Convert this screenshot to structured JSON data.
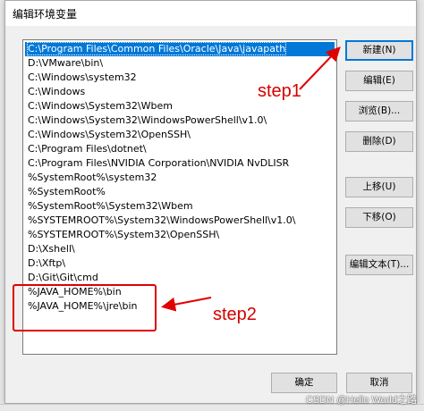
{
  "dialog": {
    "title": "编辑环境变量"
  },
  "paths": [
    "C:\\Program Files\\Common Files\\Oracle\\Java\\javapath",
    "D:\\VMware\\bin\\",
    "C:\\Windows\\system32",
    "C:\\Windows",
    "C:\\Windows\\System32\\Wbem",
    "C:\\Windows\\System32\\WindowsPowerShell\\v1.0\\",
    "C:\\Windows\\System32\\OpenSSH\\",
    "C:\\Program Files\\dotnet\\",
    "C:\\Program Files\\NVIDIA Corporation\\NVIDIA NvDLISR",
    "%SystemRoot%\\system32",
    "%SystemRoot%",
    "%SystemRoot%\\System32\\Wbem",
    "%SYSTEMROOT%\\System32\\WindowsPowerShell\\v1.0\\",
    "%SYSTEMROOT%\\System32\\OpenSSH\\",
    "D:\\Xshell\\",
    "D:\\Xftp\\",
    "D:\\Git\\Git\\cmd",
    "%JAVA_HOME%\\bin",
    "%JAVA_HOME%\\jre\\bin"
  ],
  "buttons": {
    "new": "新建(N)",
    "edit": "编辑(E)",
    "browse": "浏览(B)...",
    "delete": "删除(D)",
    "move_up": "上移(U)",
    "move_down": "下移(O)",
    "edit_text": "编辑文本(T)..."
  },
  "footer": {
    "ok": "确定",
    "cancel": "取消"
  },
  "annotations": {
    "step1": "step1",
    "step2": "step2",
    "color": "#e00000"
  },
  "watermark": "CSDN @Hello World之路",
  "colors": {
    "selection": "#0078d7",
    "annotation": "#e00000"
  }
}
